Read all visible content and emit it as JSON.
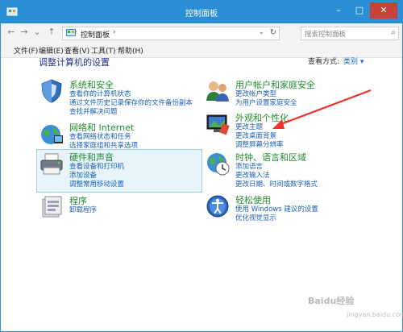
{
  "window": {
    "title": "控制面板"
  },
  "controls": {
    "minimize": "–",
    "maximize": "□",
    "close": "✕"
  },
  "nav": {
    "back": "←",
    "forward": "→",
    "dropdown": "⌄",
    "up": "↑"
  },
  "address": {
    "path": "控制面板",
    "separator": "›"
  },
  "search": {
    "placeholder": "搜索控制面板"
  },
  "menu": [
    "文件(F)",
    "编辑(E)",
    "查看(V)",
    "工具(T)",
    "帮助(H)"
  ],
  "page": {
    "title": "调整计算机的设置",
    "view_label": "查看方式:",
    "view_value": "类别 ▾"
  },
  "categories": [
    {
      "heading": "系统和安全",
      "icon": "shield-icon",
      "links": [
        "查看你的计算机状态",
        "通过文件历史记录保存你的文件备份副本",
        "查找并解决问题"
      ]
    },
    {
      "heading": "网络和 Internet",
      "icon": "network-globe-icon",
      "links": [
        "查看网络状态和任务",
        "选择家庭组和共享选项"
      ]
    },
    {
      "heading": "硬件和声音",
      "icon": "printer-icon",
      "links": [
        "查看设备和打印机",
        "添加设备",
        "调整常用移动设置"
      ]
    },
    {
      "heading": "程序",
      "icon": "programs-icon",
      "links": [
        "卸载程序"
      ]
    },
    {
      "heading": "用户帐户和家庭安全",
      "icon": "users-icon",
      "links": [
        "更改帐户类型",
        "为用户设置家庭安全"
      ]
    },
    {
      "heading": "外观和个性化",
      "icon": "display-icon",
      "links": [
        "更改主题",
        "更改桌面背景",
        "调整屏幕分辨率"
      ]
    },
    {
      "heading": "时钟、语言和区域",
      "icon": "clock-globe-icon",
      "links": [
        "添加语言",
        "更改输入法",
        "更改日期、时间或数字格式"
      ]
    },
    {
      "heading": "轻松使用",
      "icon": "accessibility-icon",
      "links": [
        "使用 Windows 建议的设置",
        "优化视觉显示"
      ]
    }
  ],
  "watermark": {
    "text": "Baidu经验",
    "sub": "jingyan.baidu.com"
  },
  "colors": {
    "titlebar": "#2b8fd6",
    "heading": "#1e8a2e",
    "link": "#1a5fb4",
    "arrow": "#e8342c",
    "highlight": "#e8f4fb"
  }
}
